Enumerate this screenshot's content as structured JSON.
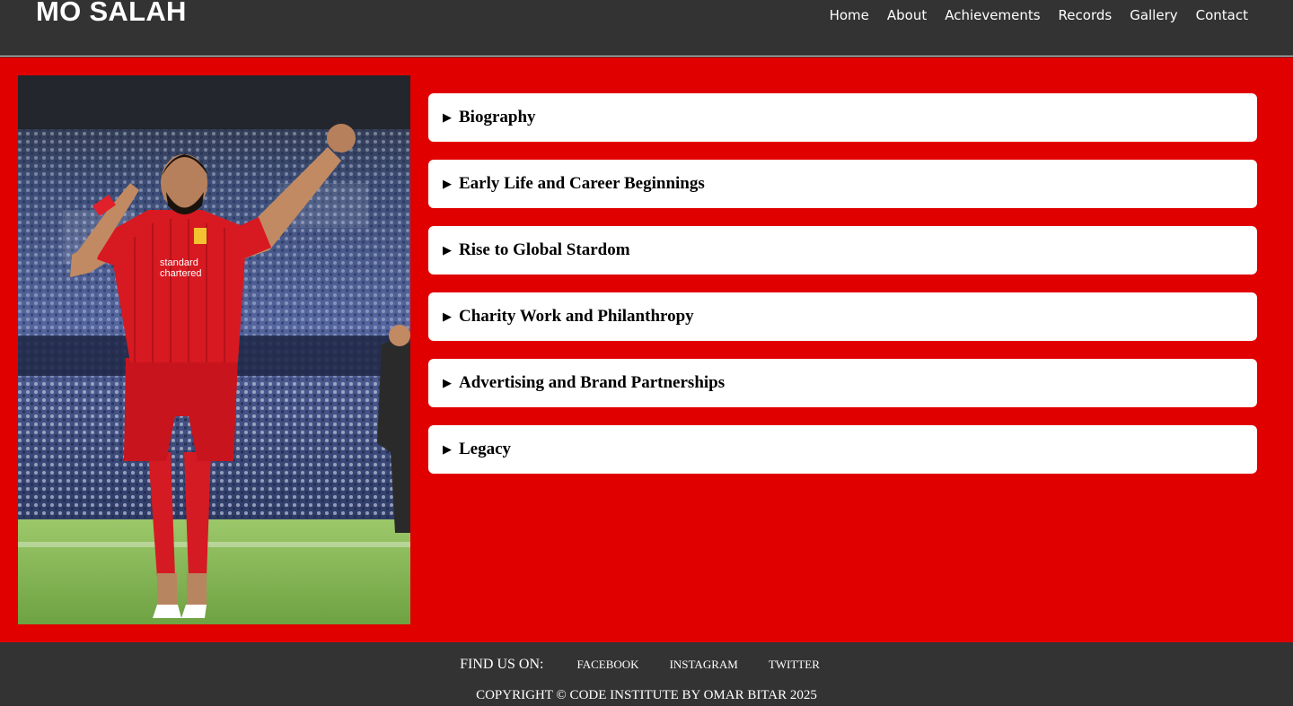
{
  "header": {
    "logo": "MO SALAH",
    "nav": [
      "Home",
      "About",
      "Achievements",
      "Records",
      "Gallery",
      "Contact"
    ]
  },
  "main": {
    "photo_alt": "Mo Salah celebrating in Liverpool kit",
    "accordion": [
      "Biography",
      "Early Life and Career Beginnings",
      "Rise to Global Stardom",
      "Charity Work and Philanthropy",
      "Advertising and Brand Partnerships",
      "Legacy"
    ]
  },
  "footer": {
    "find_us": "FIND US ON:",
    "links": [
      "FACEBOOK",
      "INSTAGRAM",
      "TWITTER"
    ],
    "copyright": "COPYRIGHT © CODE INSTITUTE BY OMAR BITAR 2025"
  },
  "colors": {
    "header_bg": "#333333",
    "main_bg": "#e00000",
    "card_bg": "#ffffff"
  }
}
